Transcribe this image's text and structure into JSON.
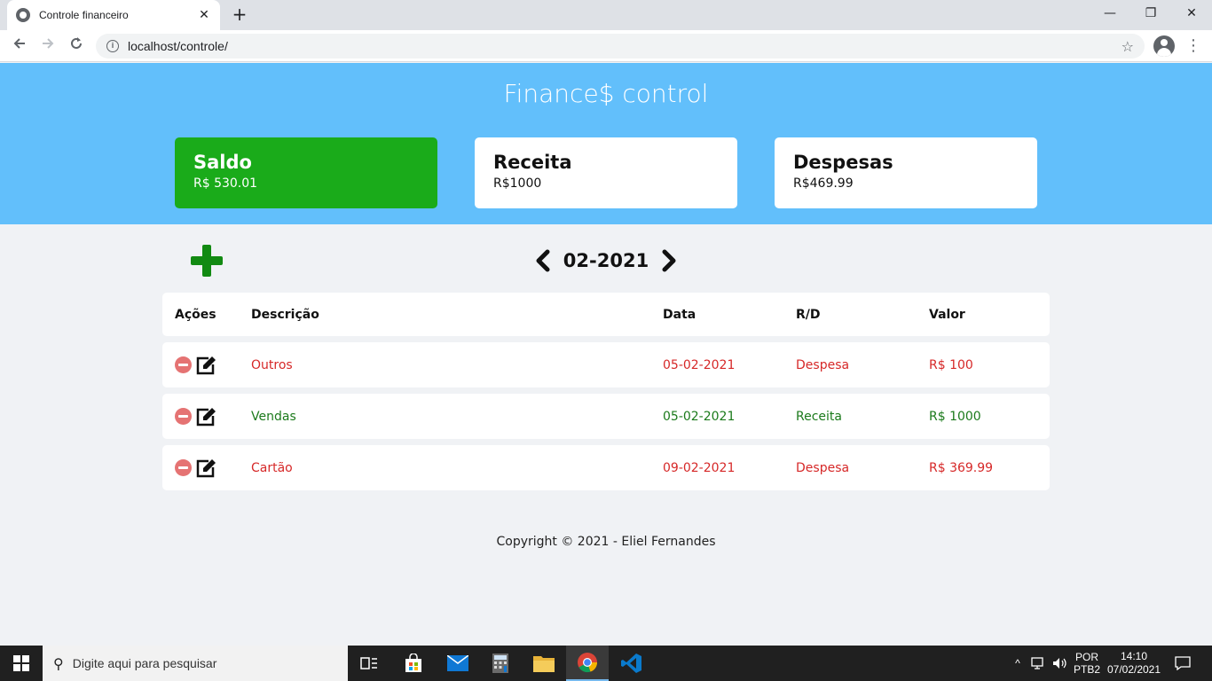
{
  "browser": {
    "tab_title": "Controle financeiro",
    "tab_close": "✕",
    "new_tab": "+",
    "url": "localhost/controle/",
    "win_minimize": "—",
    "win_restore": "❐",
    "win_close": "✕"
  },
  "header": {
    "title": "Finance$ control"
  },
  "cards": [
    {
      "label": "Saldo",
      "value": "R$ 530.01",
      "color": "#1aab1a"
    },
    {
      "label": "Receita",
      "value": "R$1000"
    },
    {
      "label": "Despesas",
      "value": "R$469.99"
    }
  ],
  "month_nav": {
    "current": "02-2021"
  },
  "table": {
    "headers": [
      "Ações",
      "Descrição",
      "Data",
      "R/D",
      "Valor"
    ],
    "rows": [
      {
        "descricao": "Outros",
        "data": "05-02-2021",
        "tipo": "Despesa",
        "valor": "R$ 100"
      },
      {
        "descricao": "Vendas",
        "data": "05-02-2021",
        "tipo": "Receita",
        "valor": "R$ 1000"
      },
      {
        "descricao": "Cartão",
        "data": "09-02-2021",
        "tipo": "Despesa",
        "valor": "R$ 369.99"
      }
    ]
  },
  "colors": {
    "header_bg": "#62bffb",
    "saldo_bg": "#1aab1a",
    "despesa": "#d62828",
    "receita": "#1b7a1b",
    "add_button": "#128a12"
  },
  "footer": {
    "text": "Copyright © 2021 - Eliel Fernandes"
  },
  "taskbar": {
    "search_placeholder": "Digite aqui para pesquisar",
    "lang_top": "POR",
    "lang_bottom": "PTB2",
    "time": "14:10",
    "date": "07/02/2021"
  }
}
